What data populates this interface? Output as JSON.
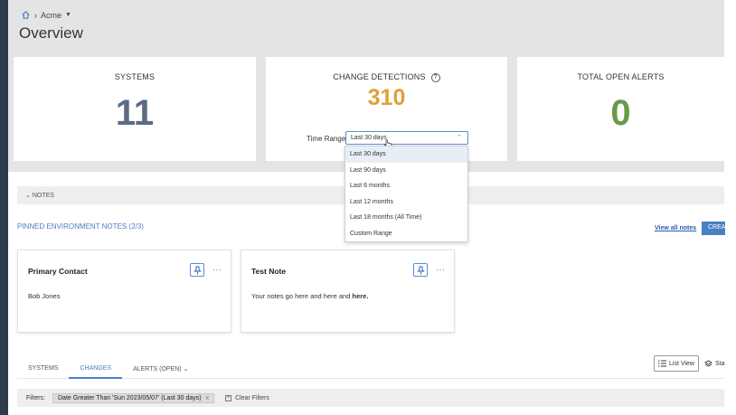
{
  "breadcrumb": {
    "current": "Acme"
  },
  "page": {
    "title": "Overview"
  },
  "stats": {
    "systems": {
      "label": "SYSTEMS",
      "value": "11",
      "color": "#5a6b83"
    },
    "changes": {
      "label": "CHANGE DETECTIONS",
      "value": "310",
      "color": "#e0a035"
    },
    "alerts": {
      "label": "TOTAL OPEN ALERTS",
      "value": "0",
      "color": "#6a9a48"
    }
  },
  "time_range": {
    "label": "Time Range",
    "selected": "Last 30 days",
    "options": [
      "Last 30 days",
      "Last 90 days",
      "Last 6 months",
      "Last 12 months",
      "Last 18 months (All Time)",
      "Custom Range"
    ]
  },
  "notes": {
    "section_label": "NOTES",
    "pinned_title": "PINNED ENVIRONMENT NOTES (2/3)",
    "view_all": "View all notes",
    "create_label": "CREA",
    "cards": [
      {
        "title": "Primary Contact",
        "body": "Bob Jones"
      },
      {
        "title": "Test Note",
        "body_prefix": "Your notes go here and here and ",
        "body_bold": "here."
      }
    ]
  },
  "tabs": [
    "SYSTEMS",
    "CHANGES",
    "ALERTS (OPEN)"
  ],
  "view_buttons": {
    "list_view": "List View",
    "stack": "Sta"
  },
  "filters": {
    "label": "Filters:",
    "chip": "Date Greater Than 'Sun 2023/05/07' (Last 30 days)",
    "chip_close": "x",
    "clear": "Clear Filters"
  },
  "colors": {
    "accent": "#4a7fc1",
    "rail": "#2e3b4e"
  }
}
